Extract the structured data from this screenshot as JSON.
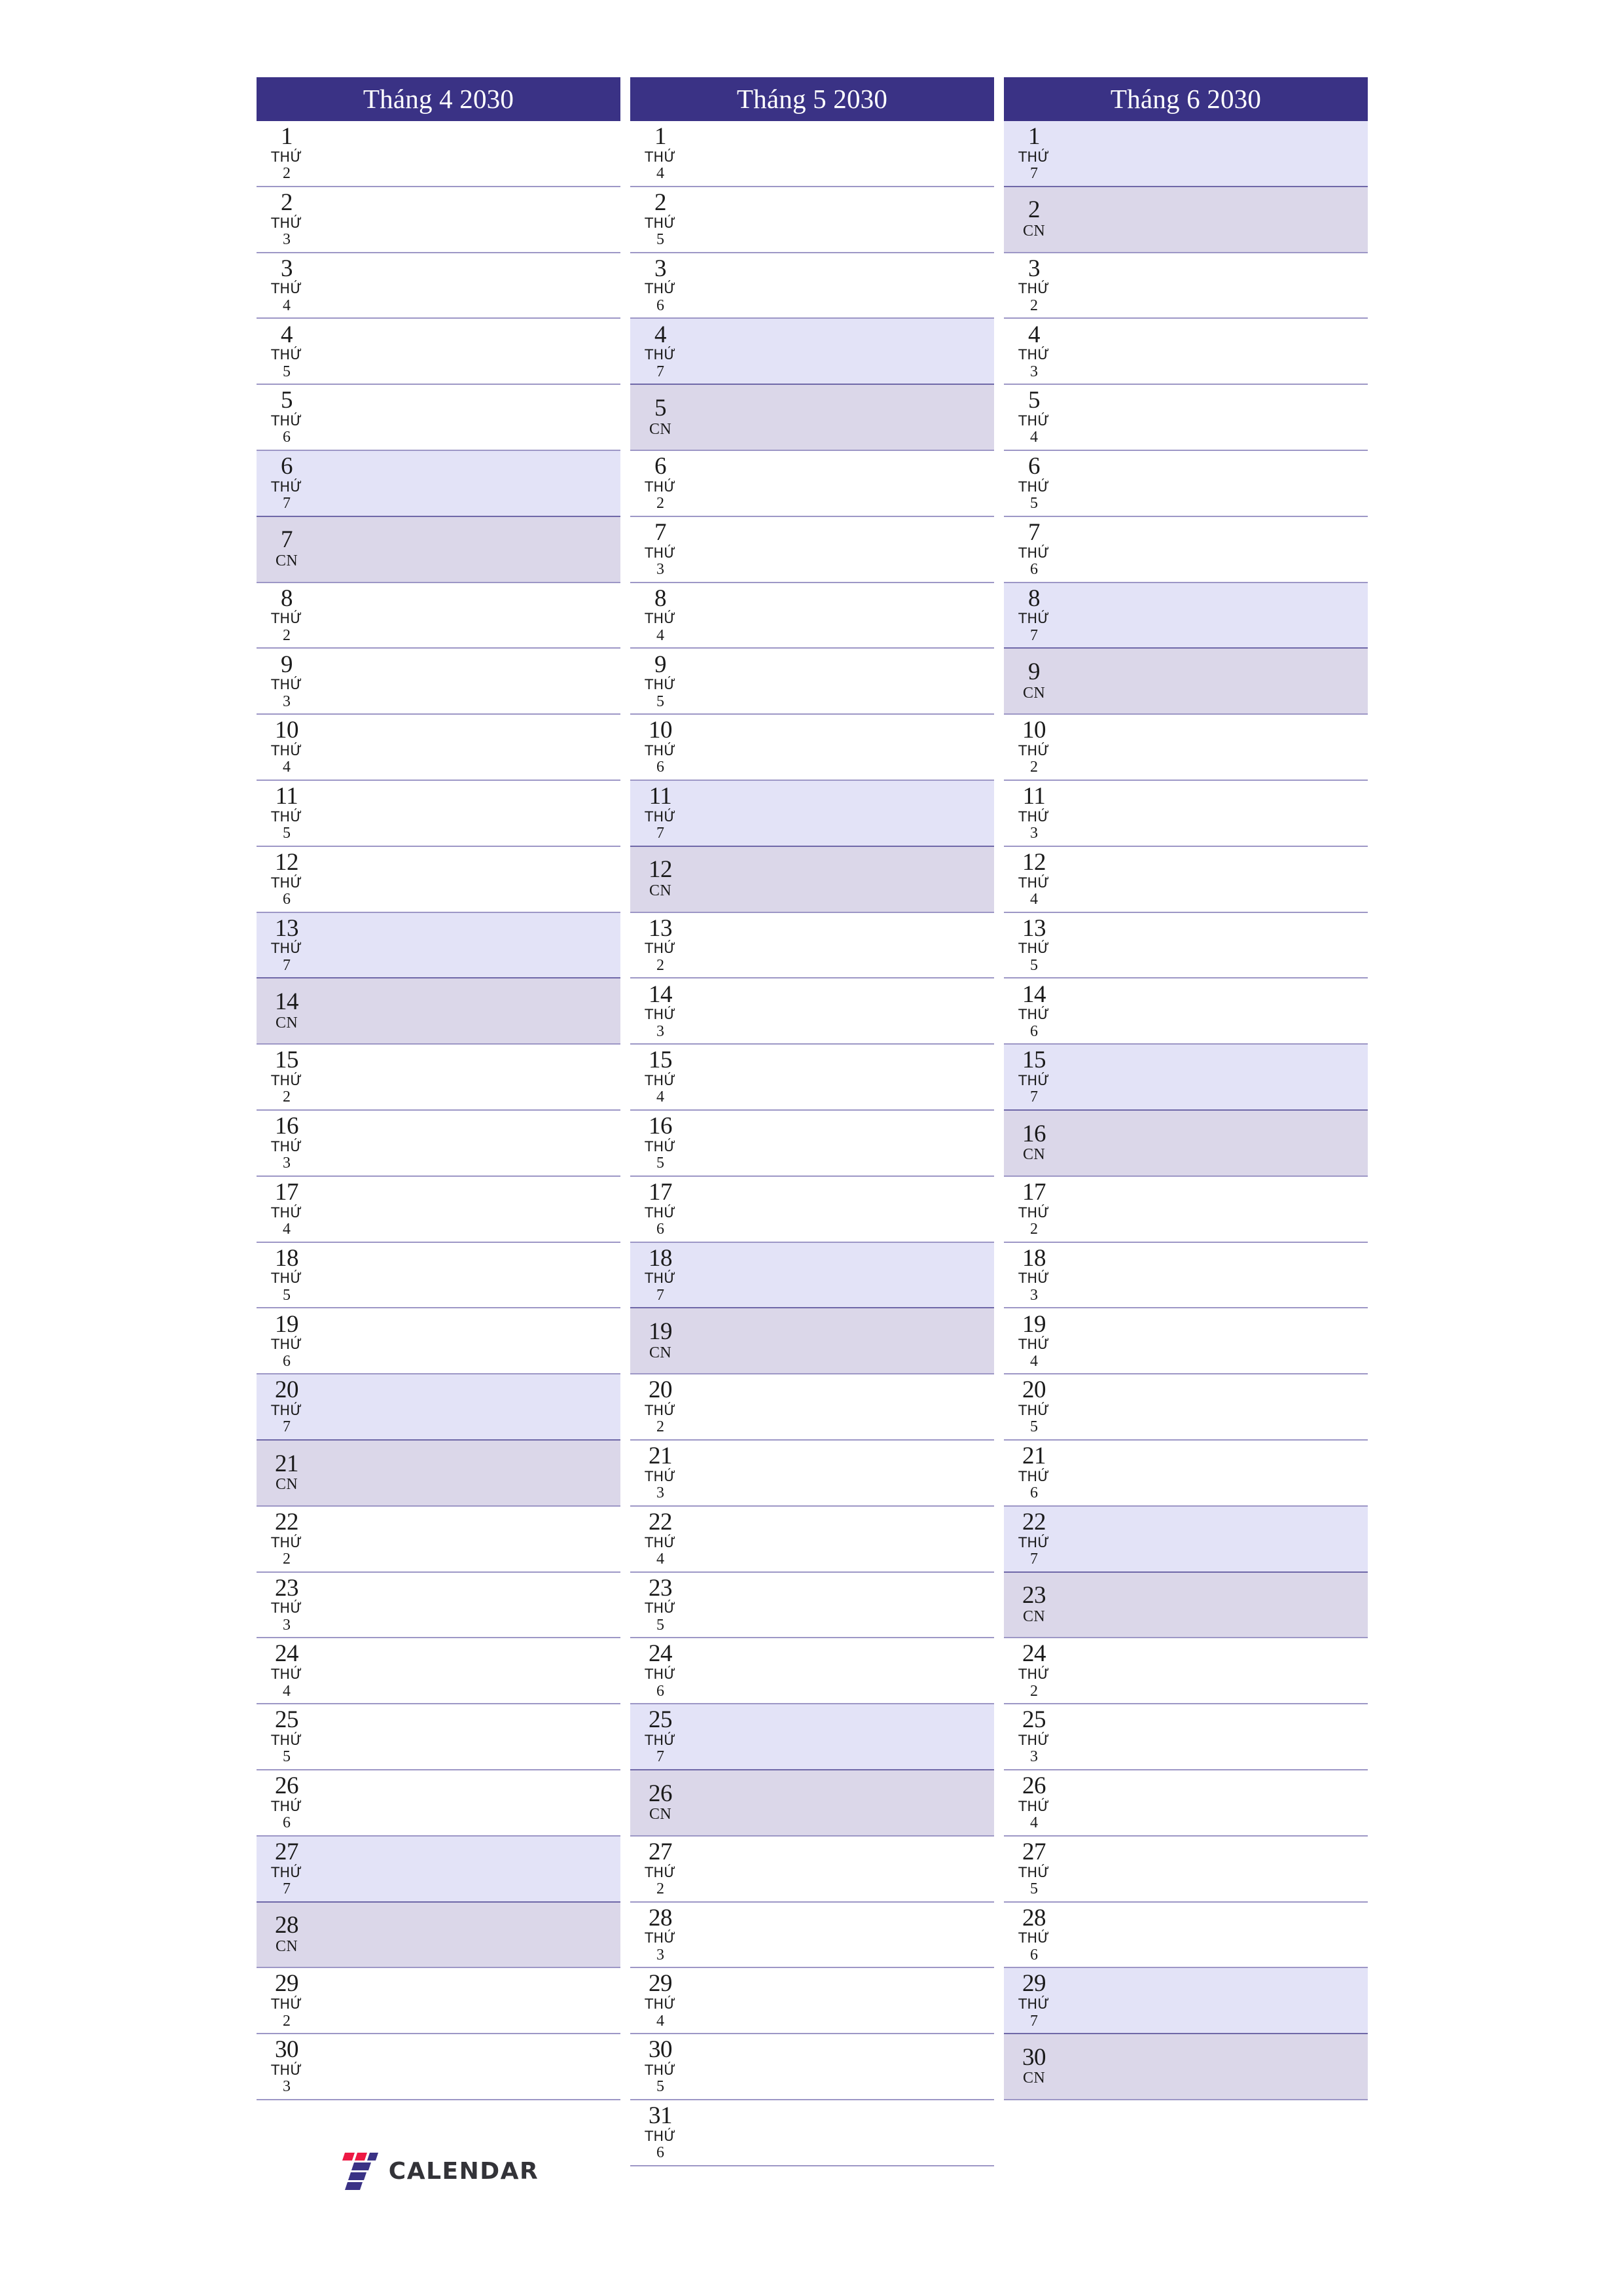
{
  "brand": {
    "logo_icon": "seven-calendar-logo-icon",
    "name": "CALENDAR",
    "mark_colors": [
      "#ed1944",
      "#3a3285"
    ]
  },
  "colors": {
    "header_bg": "#3a3285",
    "header_text": "#ffffff",
    "saturday_bg": "#e3e3f7",
    "sunday_bg": "#dbd7e9",
    "rule": "#9d97c6",
    "page_bg": "#ffffff",
    "text": "#1a1a1a"
  },
  "labels": {
    "weekday_prefix": "THỨ",
    "sunday": "CN"
  },
  "months": [
    {
      "title": "Tháng 4 2030",
      "month_number": 4,
      "year": 2030,
      "days": [
        {
          "day": 1,
          "dow": "THỨ",
          "dow_num": "2",
          "type": "weekday"
        },
        {
          "day": 2,
          "dow": "THỨ",
          "dow_num": "3",
          "type": "weekday"
        },
        {
          "day": 3,
          "dow": "THỨ",
          "dow_num": "4",
          "type": "weekday"
        },
        {
          "day": 4,
          "dow": "THỨ",
          "dow_num": "5",
          "type": "weekday"
        },
        {
          "day": 5,
          "dow": "THỨ",
          "dow_num": "6",
          "type": "weekday"
        },
        {
          "day": 6,
          "dow": "THỨ",
          "dow_num": "7",
          "type": "sat"
        },
        {
          "day": 7,
          "dow": "CN",
          "dow_num": "",
          "type": "sun"
        },
        {
          "day": 8,
          "dow": "THỨ",
          "dow_num": "2",
          "type": "weekday"
        },
        {
          "day": 9,
          "dow": "THỨ",
          "dow_num": "3",
          "type": "weekday"
        },
        {
          "day": 10,
          "dow": "THỨ",
          "dow_num": "4",
          "type": "weekday"
        },
        {
          "day": 11,
          "dow": "THỨ",
          "dow_num": "5",
          "type": "weekday"
        },
        {
          "day": 12,
          "dow": "THỨ",
          "dow_num": "6",
          "type": "weekday"
        },
        {
          "day": 13,
          "dow": "THỨ",
          "dow_num": "7",
          "type": "sat"
        },
        {
          "day": 14,
          "dow": "CN",
          "dow_num": "",
          "type": "sun"
        },
        {
          "day": 15,
          "dow": "THỨ",
          "dow_num": "2",
          "type": "weekday"
        },
        {
          "day": 16,
          "dow": "THỨ",
          "dow_num": "3",
          "type": "weekday"
        },
        {
          "day": 17,
          "dow": "THỨ",
          "dow_num": "4",
          "type": "weekday"
        },
        {
          "day": 18,
          "dow": "THỨ",
          "dow_num": "5",
          "type": "weekday"
        },
        {
          "day": 19,
          "dow": "THỨ",
          "dow_num": "6",
          "type": "weekday"
        },
        {
          "day": 20,
          "dow": "THỨ",
          "dow_num": "7",
          "type": "sat"
        },
        {
          "day": 21,
          "dow": "CN",
          "dow_num": "",
          "type": "sun"
        },
        {
          "day": 22,
          "dow": "THỨ",
          "dow_num": "2",
          "type": "weekday"
        },
        {
          "day": 23,
          "dow": "THỨ",
          "dow_num": "3",
          "type": "weekday"
        },
        {
          "day": 24,
          "dow": "THỨ",
          "dow_num": "4",
          "type": "weekday"
        },
        {
          "day": 25,
          "dow": "THỨ",
          "dow_num": "5",
          "type": "weekday"
        },
        {
          "day": 26,
          "dow": "THỨ",
          "dow_num": "6",
          "type": "weekday"
        },
        {
          "day": 27,
          "dow": "THỨ",
          "dow_num": "7",
          "type": "sat"
        },
        {
          "day": 28,
          "dow": "CN",
          "dow_num": "",
          "type": "sun"
        },
        {
          "day": 29,
          "dow": "THỨ",
          "dow_num": "2",
          "type": "weekday"
        },
        {
          "day": 30,
          "dow": "THỨ",
          "dow_num": "3",
          "type": "weekday"
        }
      ]
    },
    {
      "title": "Tháng 5 2030",
      "month_number": 5,
      "year": 2030,
      "days": [
        {
          "day": 1,
          "dow": "THỨ",
          "dow_num": "4",
          "type": "weekday"
        },
        {
          "day": 2,
          "dow": "THỨ",
          "dow_num": "5",
          "type": "weekday"
        },
        {
          "day": 3,
          "dow": "THỨ",
          "dow_num": "6",
          "type": "weekday"
        },
        {
          "day": 4,
          "dow": "THỨ",
          "dow_num": "7",
          "type": "sat"
        },
        {
          "day": 5,
          "dow": "CN",
          "dow_num": "",
          "type": "sun"
        },
        {
          "day": 6,
          "dow": "THỨ",
          "dow_num": "2",
          "type": "weekday"
        },
        {
          "day": 7,
          "dow": "THỨ",
          "dow_num": "3",
          "type": "weekday"
        },
        {
          "day": 8,
          "dow": "THỨ",
          "dow_num": "4",
          "type": "weekday"
        },
        {
          "day": 9,
          "dow": "THỨ",
          "dow_num": "5",
          "type": "weekday"
        },
        {
          "day": 10,
          "dow": "THỨ",
          "dow_num": "6",
          "type": "weekday"
        },
        {
          "day": 11,
          "dow": "THỨ",
          "dow_num": "7",
          "type": "sat"
        },
        {
          "day": 12,
          "dow": "CN",
          "dow_num": "",
          "type": "sun"
        },
        {
          "day": 13,
          "dow": "THỨ",
          "dow_num": "2",
          "type": "weekday"
        },
        {
          "day": 14,
          "dow": "THỨ",
          "dow_num": "3",
          "type": "weekday"
        },
        {
          "day": 15,
          "dow": "THỨ",
          "dow_num": "4",
          "type": "weekday"
        },
        {
          "day": 16,
          "dow": "THỨ",
          "dow_num": "5",
          "type": "weekday"
        },
        {
          "day": 17,
          "dow": "THỨ",
          "dow_num": "6",
          "type": "weekday"
        },
        {
          "day": 18,
          "dow": "THỨ",
          "dow_num": "7",
          "type": "sat"
        },
        {
          "day": 19,
          "dow": "CN",
          "dow_num": "",
          "type": "sun"
        },
        {
          "day": 20,
          "dow": "THỨ",
          "dow_num": "2",
          "type": "weekday"
        },
        {
          "day": 21,
          "dow": "THỨ",
          "dow_num": "3",
          "type": "weekday"
        },
        {
          "day": 22,
          "dow": "THỨ",
          "dow_num": "4",
          "type": "weekday"
        },
        {
          "day": 23,
          "dow": "THỨ",
          "dow_num": "5",
          "type": "weekday"
        },
        {
          "day": 24,
          "dow": "THỨ",
          "dow_num": "6",
          "type": "weekday"
        },
        {
          "day": 25,
          "dow": "THỨ",
          "dow_num": "7",
          "type": "sat"
        },
        {
          "day": 26,
          "dow": "CN",
          "dow_num": "",
          "type": "sun"
        },
        {
          "day": 27,
          "dow": "THỨ",
          "dow_num": "2",
          "type": "weekday"
        },
        {
          "day": 28,
          "dow": "THỨ",
          "dow_num": "3",
          "type": "weekday"
        },
        {
          "day": 29,
          "dow": "THỨ",
          "dow_num": "4",
          "type": "weekday"
        },
        {
          "day": 30,
          "dow": "THỨ",
          "dow_num": "5",
          "type": "weekday"
        },
        {
          "day": 31,
          "dow": "THỨ",
          "dow_num": "6",
          "type": "weekday"
        }
      ]
    },
    {
      "title": "Tháng 6 2030",
      "month_number": 6,
      "year": 2030,
      "days": [
        {
          "day": 1,
          "dow": "THỨ",
          "dow_num": "7",
          "type": "sat"
        },
        {
          "day": 2,
          "dow": "CN",
          "dow_num": "",
          "type": "sun"
        },
        {
          "day": 3,
          "dow": "THỨ",
          "dow_num": "2",
          "type": "weekday"
        },
        {
          "day": 4,
          "dow": "THỨ",
          "dow_num": "3",
          "type": "weekday"
        },
        {
          "day": 5,
          "dow": "THỨ",
          "dow_num": "4",
          "type": "weekday"
        },
        {
          "day": 6,
          "dow": "THỨ",
          "dow_num": "5",
          "type": "weekday"
        },
        {
          "day": 7,
          "dow": "THỨ",
          "dow_num": "6",
          "type": "weekday"
        },
        {
          "day": 8,
          "dow": "THỨ",
          "dow_num": "7",
          "type": "sat"
        },
        {
          "day": 9,
          "dow": "CN",
          "dow_num": "",
          "type": "sun"
        },
        {
          "day": 10,
          "dow": "THỨ",
          "dow_num": "2",
          "type": "weekday"
        },
        {
          "day": 11,
          "dow": "THỨ",
          "dow_num": "3",
          "type": "weekday"
        },
        {
          "day": 12,
          "dow": "THỨ",
          "dow_num": "4",
          "type": "weekday"
        },
        {
          "day": 13,
          "dow": "THỨ",
          "dow_num": "5",
          "type": "weekday"
        },
        {
          "day": 14,
          "dow": "THỨ",
          "dow_num": "6",
          "type": "weekday"
        },
        {
          "day": 15,
          "dow": "THỨ",
          "dow_num": "7",
          "type": "sat"
        },
        {
          "day": 16,
          "dow": "CN",
          "dow_num": "",
          "type": "sun"
        },
        {
          "day": 17,
          "dow": "THỨ",
          "dow_num": "2",
          "type": "weekday"
        },
        {
          "day": 18,
          "dow": "THỨ",
          "dow_num": "3",
          "type": "weekday"
        },
        {
          "day": 19,
          "dow": "THỨ",
          "dow_num": "4",
          "type": "weekday"
        },
        {
          "day": 20,
          "dow": "THỨ",
          "dow_num": "5",
          "type": "weekday"
        },
        {
          "day": 21,
          "dow": "THỨ",
          "dow_num": "6",
          "type": "weekday"
        },
        {
          "day": 22,
          "dow": "THỨ",
          "dow_num": "7",
          "type": "sat"
        },
        {
          "day": 23,
          "dow": "CN",
          "dow_num": "",
          "type": "sun"
        },
        {
          "day": 24,
          "dow": "THỨ",
          "dow_num": "2",
          "type": "weekday"
        },
        {
          "day": 25,
          "dow": "THỨ",
          "dow_num": "3",
          "type": "weekday"
        },
        {
          "day": 26,
          "dow": "THỨ",
          "dow_num": "4",
          "type": "weekday"
        },
        {
          "day": 27,
          "dow": "THỨ",
          "dow_num": "5",
          "type": "weekday"
        },
        {
          "day": 28,
          "dow": "THỨ",
          "dow_num": "6",
          "type": "weekday"
        },
        {
          "day": 29,
          "dow": "THỨ",
          "dow_num": "7",
          "type": "sat"
        },
        {
          "day": 30,
          "dow": "CN",
          "dow_num": "",
          "type": "sun"
        }
      ]
    }
  ]
}
